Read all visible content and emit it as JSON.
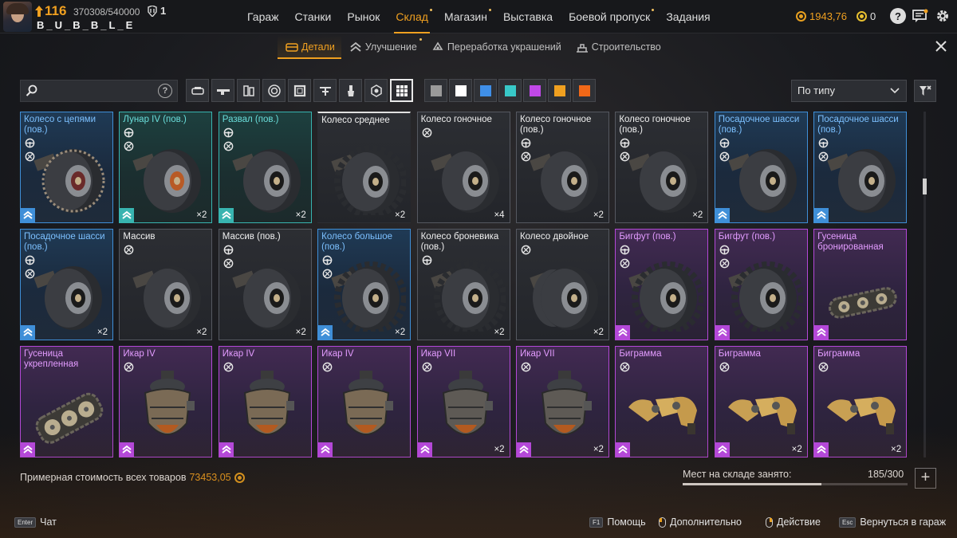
{
  "player": {
    "level": "116",
    "xp": "370308/540000",
    "rank": "1",
    "nickname": "B_U_B_B_L_E"
  },
  "nav": [
    {
      "label": "Гараж",
      "active": false,
      "dot": false
    },
    {
      "label": "Станки",
      "active": false,
      "dot": false
    },
    {
      "label": "Рынок",
      "active": false,
      "dot": false
    },
    {
      "label": "Склад",
      "active": true,
      "dot": true
    },
    {
      "label": "Магазин",
      "active": false,
      "dot": true
    },
    {
      "label": "Выставка",
      "active": false,
      "dot": false
    },
    {
      "label": "Боевой пропуск",
      "active": false,
      "dot": true
    },
    {
      "label": "Задания",
      "active": false,
      "dot": false
    }
  ],
  "currency": {
    "coins": "1943,76",
    "badges": "0"
  },
  "subtabs": [
    {
      "label": "Детали",
      "active": true,
      "icon": "parts-icon",
      "dot": false
    },
    {
      "label": "Улучшение",
      "active": false,
      "icon": "upgrade-icon",
      "dot": true
    },
    {
      "label": "Переработка украшений",
      "active": false,
      "icon": "recycle-icon",
      "dot": false
    },
    {
      "label": "Строительство",
      "active": false,
      "icon": "build-icon",
      "dot": false
    }
  ],
  "search": {
    "placeholder": "",
    "value": ""
  },
  "filters": [
    {
      "name": "cabin-filter",
      "icon": "cabin-icon",
      "active": false
    },
    {
      "name": "weapon-filter",
      "icon": "gun-icon",
      "active": false
    },
    {
      "name": "module-filter",
      "icon": "module-icon",
      "active": false
    },
    {
      "name": "wheel-filter",
      "icon": "wheel-icon",
      "active": false
    },
    {
      "name": "frame-filter",
      "icon": "frame-icon",
      "active": false
    },
    {
      "name": "structure-filter",
      "icon": "structure-icon",
      "active": false
    },
    {
      "name": "paint-filter",
      "icon": "paint-icon",
      "active": false
    },
    {
      "name": "hex-filter",
      "icon": "hex-icon",
      "active": false
    },
    {
      "name": "all-filter",
      "icon": "grid-icon",
      "active": true
    }
  ],
  "rarity_colors": [
    {
      "name": "grey",
      "hex": "#9a9a9a"
    },
    {
      "name": "white",
      "hex": "#ffffff"
    },
    {
      "name": "blue",
      "hex": "#3f8fe8"
    },
    {
      "name": "teal",
      "hex": "#38c8c8"
    },
    {
      "name": "purple",
      "hex": "#c048e8"
    },
    {
      "name": "orange",
      "hex": "#f0a020"
    },
    {
      "name": "red-orange",
      "hex": "#f06818"
    }
  ],
  "sort": {
    "selected": "По типу"
  },
  "items": [
    {
      "name": "Колесо с цепями (пов.)",
      "rarity": "blue",
      "count": "",
      "stats": [
        "steer",
        "traction"
      ],
      "kind": "wheel-chain"
    },
    {
      "name": "Лунар IV (пов.)",
      "rarity": "teal",
      "count": "×2",
      "stats": [
        "steer",
        "traction"
      ],
      "kind": "wheel-lunar"
    },
    {
      "name": "Развал (пов.)",
      "rarity": "teal",
      "count": "×2",
      "stats": [
        "steer",
        "traction"
      ],
      "kind": "wheel"
    },
    {
      "name": "Колесо среднее",
      "rarity": "grey",
      "count": "×2",
      "stats": [],
      "kind": "wheel-offroad"
    },
    {
      "name": "Колесо гоночное",
      "rarity": "grey",
      "count": "×4",
      "stats": [
        "traction"
      ],
      "kind": "wheel"
    },
    {
      "name": "Колесо гоночное (пов.)",
      "rarity": "grey",
      "count": "×2",
      "stats": [
        "steer",
        "traction"
      ],
      "kind": "wheel"
    },
    {
      "name": "Колесо гоночное (пов.)",
      "rarity": "grey",
      "count": "×2",
      "stats": [
        "steer",
        "traction"
      ],
      "kind": "wheel"
    },
    {
      "name": "Посадочное шасси (пов.)",
      "rarity": "blue",
      "count": "",
      "stats": [
        "steer",
        "traction"
      ],
      "kind": "wheel"
    },
    {
      "name": "Посадочное шасси (пов.)",
      "rarity": "blue",
      "count": "",
      "stats": [
        "steer",
        "traction"
      ],
      "kind": "wheel"
    },
    {
      "name": "Посадочное шасси (пов.)",
      "rarity": "blue",
      "count": "×2",
      "stats": [
        "steer",
        "traction"
      ],
      "kind": "wheel"
    },
    {
      "name": "Массив",
      "rarity": "grey",
      "count": "×2",
      "stats": [
        "traction"
      ],
      "kind": "wheel"
    },
    {
      "name": "Массив (пов.)",
      "rarity": "grey",
      "count": "×2",
      "stats": [
        "steer",
        "traction"
      ],
      "kind": "wheel"
    },
    {
      "name": "Колесо большое (пов.)",
      "rarity": "blue",
      "count": "×2",
      "stats": [
        "steer",
        "traction"
      ],
      "kind": "wheel-spiked"
    },
    {
      "name": "Колесо броневика (пов.)",
      "rarity": "grey",
      "count": "×2",
      "stats": [
        "steer"
      ],
      "kind": "wheel-offroad"
    },
    {
      "name": "Колесо двойное",
      "rarity": "grey",
      "count": "×2",
      "stats": [
        "traction"
      ],
      "kind": "wheel-double"
    },
    {
      "name": "Бигфут (пов.)",
      "rarity": "purple",
      "count": "",
      "stats": [
        "steer",
        "traction"
      ],
      "kind": "wheel-bigfoot"
    },
    {
      "name": "Бигфут (пов.)",
      "rarity": "purple",
      "count": "",
      "stats": [
        "steer",
        "traction"
      ],
      "kind": "wheel-bigfoot"
    },
    {
      "name": "Гусеница бронированная",
      "rarity": "purple",
      "count": "",
      "stats": [],
      "kind": "track"
    },
    {
      "name": "Гусеница укрепленная",
      "rarity": "purple",
      "count": "",
      "stats": [],
      "kind": "track-big"
    },
    {
      "name": "Икар IV",
      "rarity": "purple",
      "count": "",
      "stats": [
        "traction"
      ],
      "kind": "hover"
    },
    {
      "name": "Икар IV",
      "rarity": "purple",
      "count": "",
      "stats": [
        "traction"
      ],
      "kind": "hover"
    },
    {
      "name": "Икар IV",
      "rarity": "purple",
      "count": "",
      "stats": [
        "traction"
      ],
      "kind": "hover"
    },
    {
      "name": "Икар VII",
      "rarity": "purple",
      "count": "×2",
      "stats": [
        "traction"
      ],
      "kind": "hover-dark"
    },
    {
      "name": "Икар VII",
      "rarity": "purple",
      "count": "×2",
      "stats": [
        "traction"
      ],
      "kind": "hover-dark"
    },
    {
      "name": "Биграмма",
      "rarity": "purple",
      "count": "",
      "stats": [
        "traction"
      ],
      "kind": "leg"
    },
    {
      "name": "Биграмма",
      "rarity": "purple",
      "count": "×2",
      "stats": [
        "traction"
      ],
      "kind": "leg"
    },
    {
      "name": "Биграмма",
      "rarity": "purple",
      "count": "×2",
      "stats": [
        "traction"
      ],
      "kind": "leg"
    }
  ],
  "footer": {
    "total_label": "Примерная стоимость всех товаров",
    "total_value": "73453,05",
    "storage_label": "Мест на складе занято:",
    "storage_value": "185/300",
    "storage_fill": 0.617,
    "plus": "+"
  },
  "hints": [
    {
      "key": "Enter",
      "label": "Чат",
      "type": "key"
    },
    {
      "key": "F1",
      "label": "Помощь",
      "type": "key"
    },
    {
      "key": "",
      "label": "Дополнительно",
      "type": "mouse-l"
    },
    {
      "key": "",
      "label": "Действие",
      "type": "mouse-r"
    },
    {
      "key": "Esc",
      "label": "Вернуться в гараж",
      "type": "key"
    }
  ]
}
